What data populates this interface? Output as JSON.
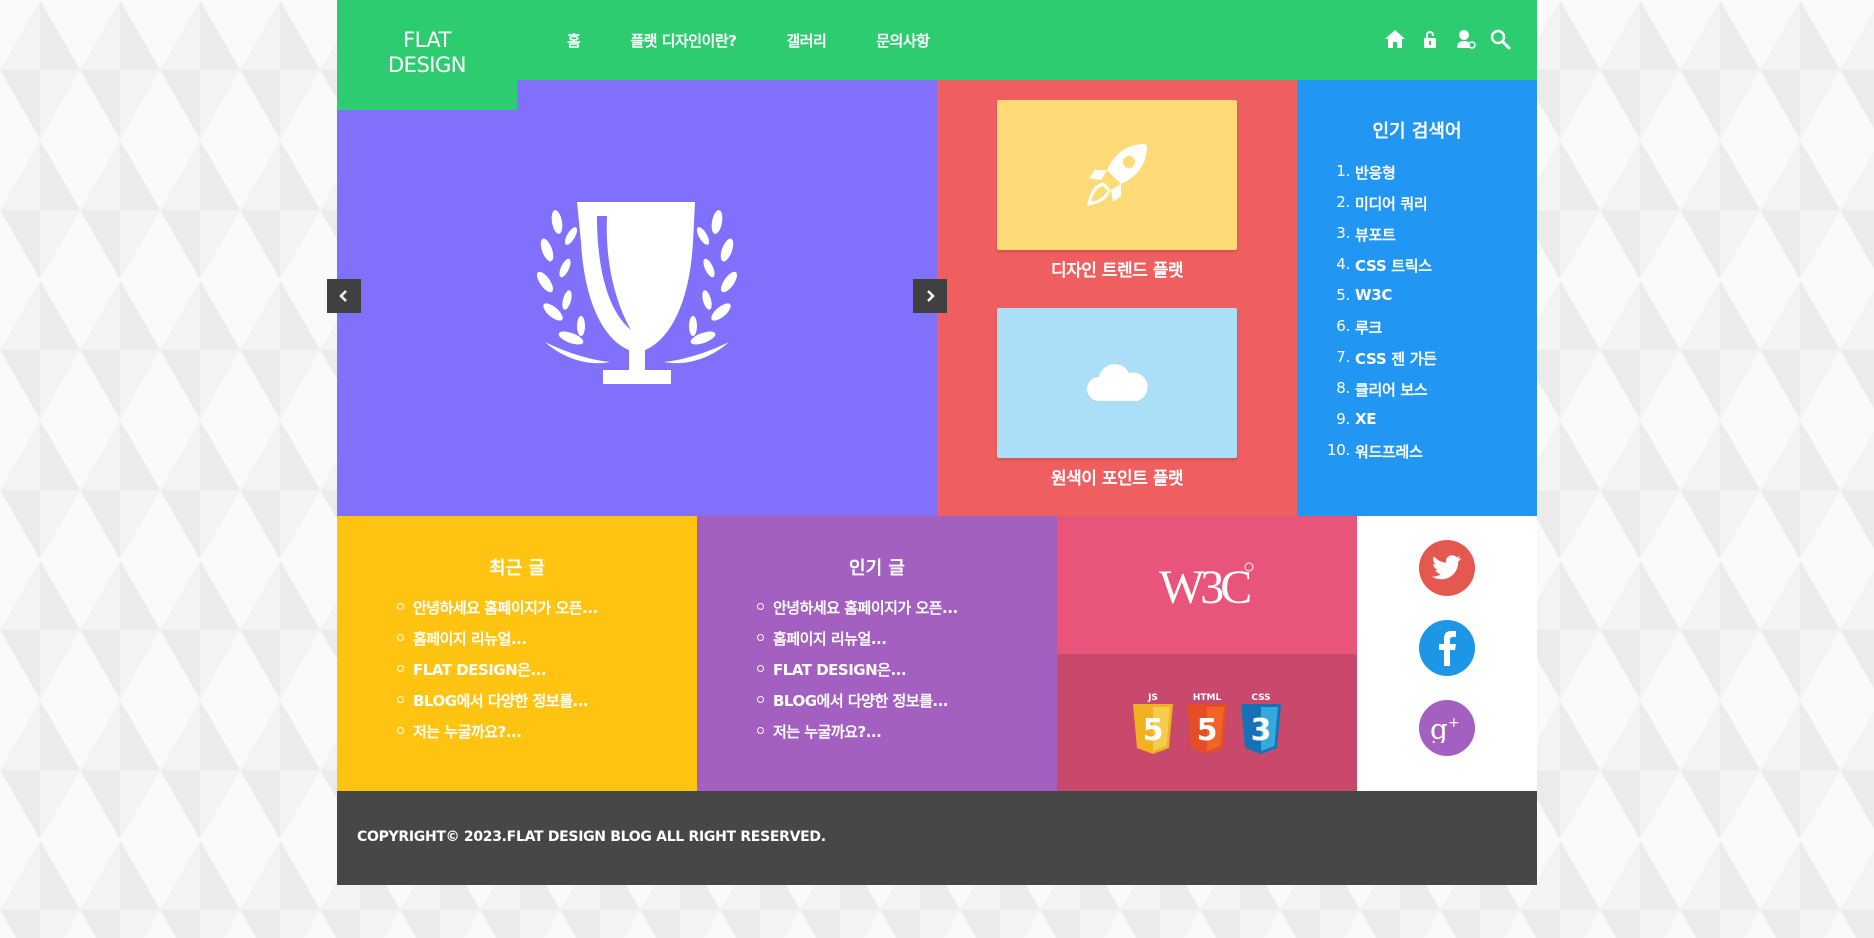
{
  "logo": {
    "line1": "FLAT",
    "line2": "DESIGN"
  },
  "nav": {
    "items": [
      {
        "label": "홈"
      },
      {
        "label": "플랫 디자인이란?"
      },
      {
        "label": "갤러리"
      },
      {
        "label": "문의사항"
      }
    ],
    "icons": [
      "home-icon",
      "lock-icon",
      "user-icon",
      "search-icon"
    ]
  },
  "slider": {
    "icon": "trophy-icon",
    "prev_icon": "chevron-left-icon",
    "next_icon": "chevron-right-icon"
  },
  "features": [
    {
      "title": "디자인 트렌드 플랫",
      "icon": "rocket-icon"
    },
    {
      "title": "원색이 포인트 플랫",
      "icon": "cloud-icon"
    }
  ],
  "popular_search": {
    "title": "인기 검색어",
    "items": [
      {
        "num": "1.",
        "label": "반응형"
      },
      {
        "num": "2.",
        "label": "미디어 쿼리"
      },
      {
        "num": "3.",
        "label": "뷰포트"
      },
      {
        "num": "4.",
        "label": "CSS 트릭스"
      },
      {
        "num": "5.",
        "label": "W3C"
      },
      {
        "num": "6.",
        "label": "루크"
      },
      {
        "num": "7.",
        "label": "CSS 젠 가든"
      },
      {
        "num": "8.",
        "label": "클리어 보스"
      },
      {
        "num": "9.",
        "label": "XE"
      },
      {
        "num": "10.",
        "label": "워드프레스"
      }
    ]
  },
  "recent_posts": {
    "title": "최근 글",
    "items": [
      "안녕하세요 홈페이지가 오픈...",
      "홈페이지 리뉴얼...",
      "FLAT DESIGN은...",
      "BLOG에서 다양한 정보를...",
      "저는 누굴까요?..."
    ]
  },
  "popular_posts": {
    "title": "인기 글",
    "items": [
      "안녕하세요 홈페이지가 오픈...",
      "홈페이지 리뉴얼...",
      "FLAT DESIGN은...",
      "BLOG에서 다양한 정보를...",
      "저는 누굴까요?..."
    ]
  },
  "w3c": {
    "logo": "W3C"
  },
  "tech": [
    {
      "label": "JS",
      "digit": "5"
    },
    {
      "label": "HTML",
      "digit": "5"
    },
    {
      "label": "CSS",
      "digit": "3"
    }
  ],
  "social": [
    "twitter-icon",
    "facebook-icon",
    "google-plus-icon"
  ],
  "footer": {
    "copyright": "COPYRIGHT© 2023.FLAT DESIGN BLOG ALL RIGHT RESERVED."
  },
  "colors": {
    "green": "#2ecc71",
    "purple": "#8070fc",
    "red": "#ef5f5f",
    "blue": "#2196f3",
    "yellow": "#ffc412",
    "violet": "#a460c0",
    "pink": "#e9557a",
    "dark": "#474747"
  }
}
